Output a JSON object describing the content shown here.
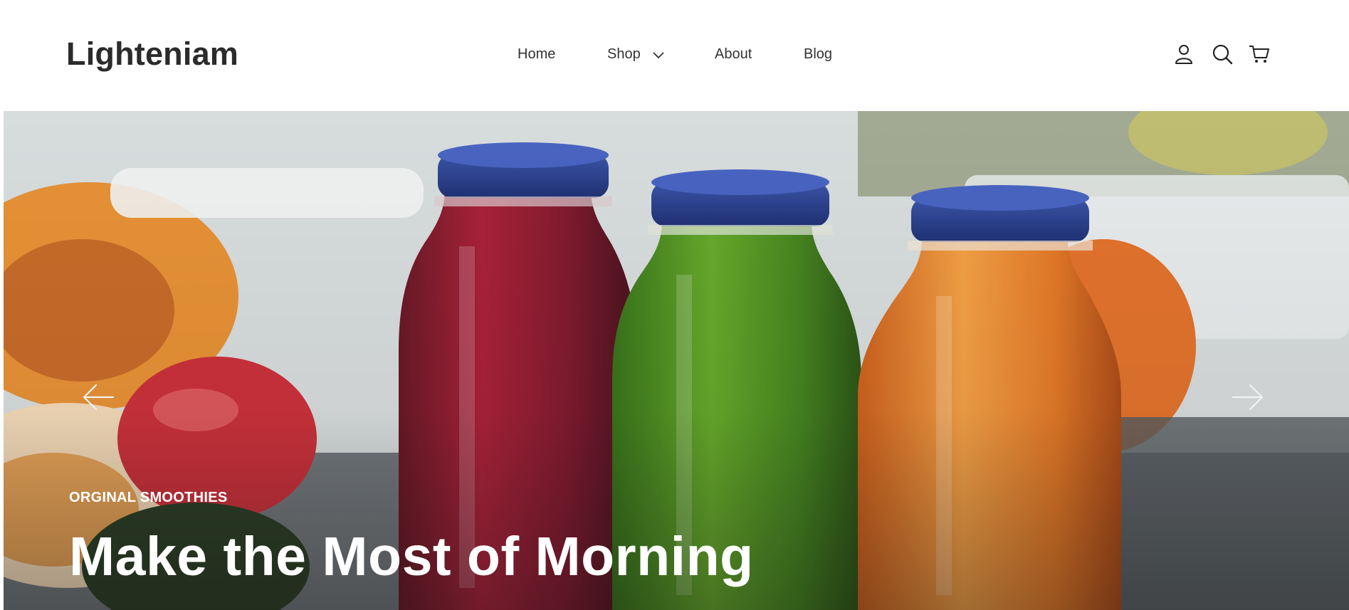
{
  "brand": {
    "name": "Lighteniam"
  },
  "nav": {
    "items": [
      {
        "label": "Home"
      },
      {
        "label": "Shop",
        "has_dropdown": true,
        "icon": "chevron-down-icon"
      },
      {
        "label": "About"
      },
      {
        "label": "Blog"
      }
    ]
  },
  "header_icons": [
    "account-icon",
    "search-icon",
    "cart-icon"
  ],
  "hero": {
    "eyebrow": "ORGINAL SMOOTHIES",
    "headline": "Make the Most of Morning",
    "prev_icon": "arrow-left-icon",
    "next_icon": "arrow-right-icon"
  },
  "colors": {
    "text": "#222222",
    "hero_text": "#ffffff",
    "bottle_cap": "#1f3a8a",
    "juice_red": "#8a0f25",
    "juice_green": "#3f8a14",
    "juice_orange": "#e0701a"
  }
}
